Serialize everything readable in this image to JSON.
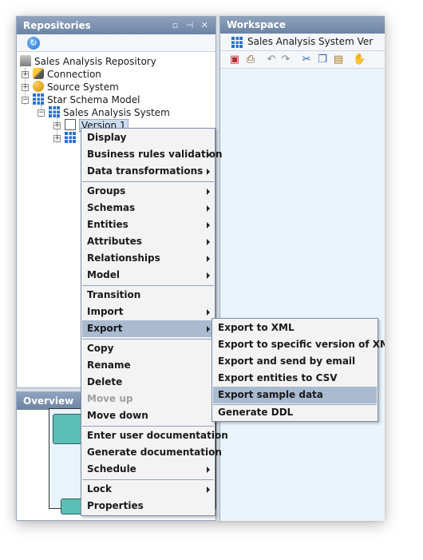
{
  "repositories": {
    "title": "Repositories",
    "controls": "▫ ⊣ ✕",
    "refresh_icon": "refresh-icon",
    "tree": [
      {
        "label": "Sales Analysis Repository",
        "icon": "repository-icon"
      },
      {
        "label": "Connection",
        "icon": "connection-icon"
      },
      {
        "label": "Source System",
        "icon": "source-system-icon"
      },
      {
        "label": "Star Schema Model",
        "icon": "star-schema-icon"
      },
      {
        "label": "Sales Analysis System",
        "icon": "system-icon"
      },
      {
        "label": "Version 1",
        "icon": "version-icon"
      }
    ]
  },
  "overview": {
    "title": "Overview"
  },
  "workspace": {
    "title": "Workspace",
    "tab_label": "Sales Analysis System Ver"
  },
  "context_menu": {
    "items": [
      {
        "label": "Display"
      },
      {
        "label": "Business rules validation"
      },
      {
        "label": "Data transformations"
      },
      {
        "label": "Groups"
      },
      {
        "label": "Schemas"
      },
      {
        "label": "Entities"
      },
      {
        "label": "Attributes"
      },
      {
        "label": "Relationships"
      },
      {
        "label": "Model"
      },
      {
        "label": "Transition"
      },
      {
        "label": "Import"
      },
      {
        "label": "Export"
      },
      {
        "label": "Copy"
      },
      {
        "label": "Rename"
      },
      {
        "label": "Delete"
      },
      {
        "label": "Move up"
      },
      {
        "label": "Move down"
      },
      {
        "label": "Enter user documentation"
      },
      {
        "label": "Generate documentation"
      },
      {
        "label": "Schedule"
      },
      {
        "label": "Lock"
      },
      {
        "label": "Properties"
      }
    ]
  },
  "export_submenu": {
    "items": [
      {
        "label": "Export to XML"
      },
      {
        "label": "Export to specific version of XML"
      },
      {
        "label": "Export and send by email"
      },
      {
        "label": "Export entities to CSV"
      },
      {
        "label": "Export sample data"
      },
      {
        "label": "Generate DDL"
      }
    ]
  },
  "colors": {
    "title_bar": "#6c83a3",
    "menu_highlight": "#a9bad1",
    "workspace_bg": "#e9f4fb"
  }
}
